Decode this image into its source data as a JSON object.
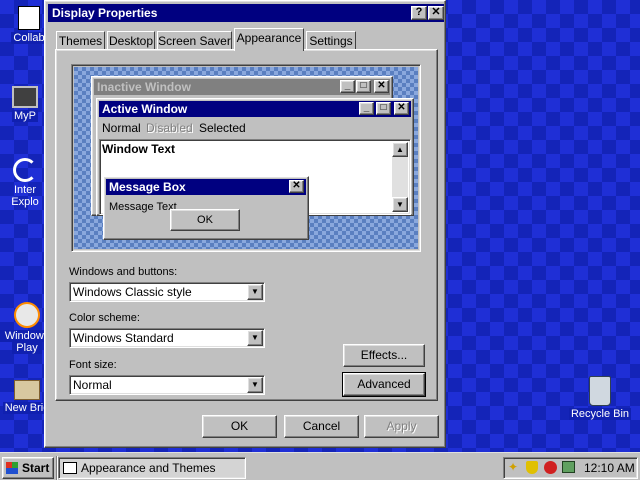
{
  "desktop": {
    "icons": [
      {
        "label": "Collab"
      },
      {
        "label": "MyP"
      },
      {
        "label": "Inter"
      },
      {
        "label": "Explo"
      },
      {
        "label": "Windows"
      },
      {
        "label": "Play"
      },
      {
        "label": "New Brie"
      },
      {
        "label": "Recycle Bin"
      }
    ]
  },
  "dialog": {
    "title": "Display Properties",
    "help_btn": "?",
    "close_btn": "✕",
    "tabs": [
      "Themes",
      "Desktop",
      "Screen Saver",
      "Appearance",
      "Settings"
    ],
    "preview": {
      "inactive_title": "Inactive Window",
      "active_title": "Active Window",
      "menu_normal": "Normal",
      "menu_disabled": "Disabled",
      "menu_selected": "Selected",
      "window_text": "Window Text",
      "msgbox_title": "Message Box",
      "msgbox_text": "Message Text",
      "msgbox_ok": "OK"
    },
    "windows_buttons_label": "Windows and buttons:",
    "windows_buttons_value": "Windows Classic style",
    "color_scheme_label": "Color scheme:",
    "color_scheme_value": "Windows Standard",
    "font_size_label": "Font size:",
    "font_size_value": "Normal",
    "effects_btn": "Effects...",
    "advanced_btn": "Advanced",
    "ok_btn": "OK",
    "cancel_btn": "Cancel",
    "apply_btn": "Apply"
  },
  "taskbar": {
    "start_label": "Start",
    "task_label": "Appearance and Themes",
    "clock": "12:10 AM"
  },
  "colors": {
    "title_active": "#000080",
    "desktop": "#1f2fd6",
    "face": "#c0c0c0"
  }
}
